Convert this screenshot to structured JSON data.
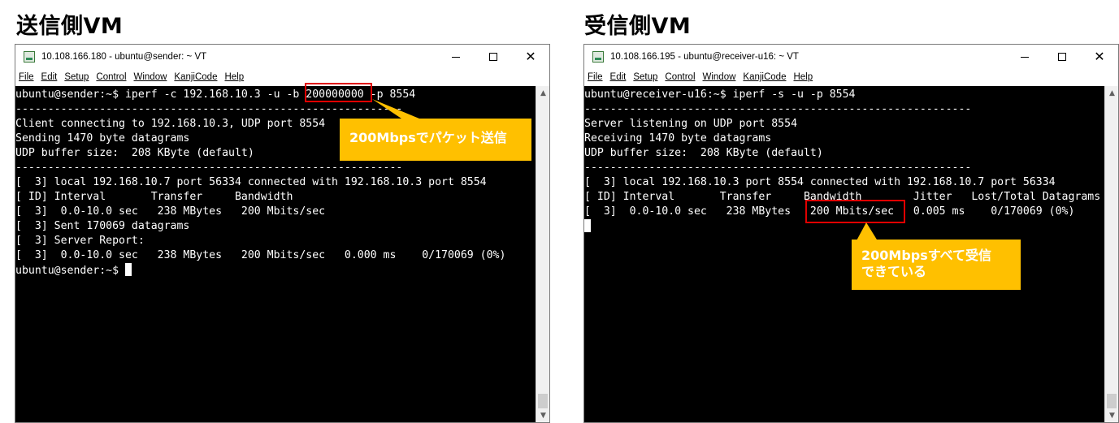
{
  "sender": {
    "heading": "送信側VM",
    "window_title": "10.108.166.180 - ubuntu@sender: ~ VT",
    "menu": [
      "File",
      "Edit",
      "Setup",
      "Control",
      "Window",
      "KanjiCode",
      "Help"
    ],
    "lines": [
      "ubuntu@sender:~$ iperf -c 192.168.10.3 -u -b 200000000 -p 8554",
      "------------------------------------------------------------",
      "Client connecting to 192.168.10.3, UDP port 8554",
      "Sending 1470 byte datagrams",
      "UDP buffer size:  208 KByte (default)",
      "------------------------------------------------------------",
      "[  3] local 192.168.10.7 port 56334 connected with 192.168.10.3 port 8554",
      "[ ID] Interval       Transfer     Bandwidth",
      "[  3]  0.0-10.0 sec   238 MBytes   200 Mbits/sec",
      "[  3] Sent 170069 datagrams",
      "[  3] Server Report:",
      "[  3]  0.0-10.0 sec   238 MBytes   200 Mbits/sec   0.000 ms    0/170069 (0%)",
      "ubuntu@sender:~$ "
    ],
    "callout": "200Mbpsでパケット送信"
  },
  "receiver": {
    "heading": "受信側VM",
    "window_title": "10.108.166.195 - ubuntu@receiver-u16: ~ VT",
    "menu": [
      "File",
      "Edit",
      "Setup",
      "Control",
      "Window",
      "KanjiCode",
      "Help"
    ],
    "lines": [
      "ubuntu@receiver-u16:~$ iperf -s -u -p 8554",
      "------------------------------------------------------------",
      "Server listening on UDP port 8554",
      "Receiving 1470 byte datagrams",
      "UDP buffer size:  208 KByte (default)",
      "------------------------------------------------------------",
      "[  3] local 192.168.10.3 port 8554 connected with 192.168.10.7 port 56334",
      "[ ID] Interval       Transfer     Bandwidth        Jitter   Lost/Total Datagrams",
      "[  3]  0.0-10.0 sec   238 MBytes   200 Mbits/sec   0.005 ms    0/170069 (0%)"
    ],
    "callout_line1": "200Mbpsすべて受信",
    "callout_line2": "できている"
  },
  "colors": {
    "terminal_bg": "#000000",
    "terminal_fg": "#ffffff",
    "highlight": "#e00000",
    "callout": "#ffc000"
  },
  "icons": [
    "teraterm-app-icon",
    "minimize-icon",
    "maximize-icon",
    "close-icon",
    "scroll-up-icon",
    "scroll-down-icon"
  ]
}
